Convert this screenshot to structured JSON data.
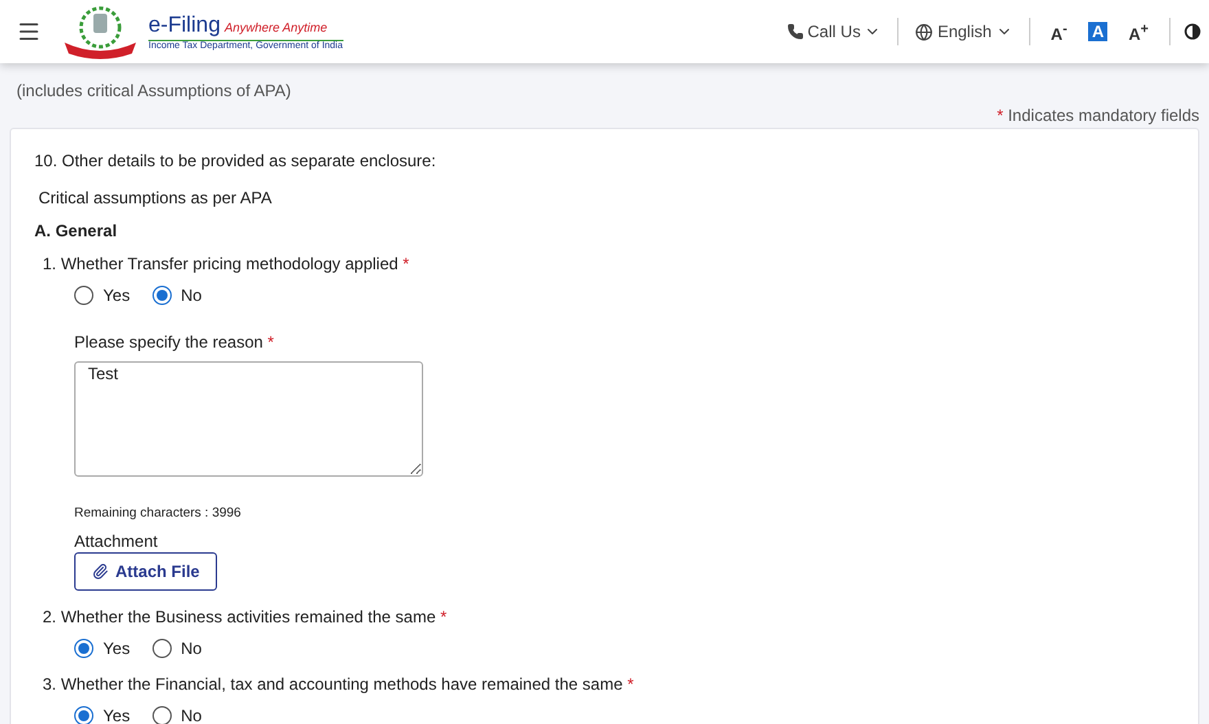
{
  "header": {
    "brand": "e-Filing",
    "tagline": "Anywhere Anytime",
    "department": "Income Tax Department, Government of India",
    "call_us": "Call Us",
    "language": "English",
    "font_controls": [
      {
        "label": "A",
        "sign": "-",
        "selected": false
      },
      {
        "label": "A",
        "selected": true
      },
      {
        "label": "A",
        "sign": "+",
        "selected": false
      }
    ]
  },
  "subtitle": "(includes critical Assumptions of APA)",
  "mandatory_mark": "*",
  "mandatory_note": "Indicates mandatory fields",
  "section_title": "10. Other details to be provided as separate enclosure:",
  "section_subtitle": "Critical assumptions as per APA",
  "group_title": "A. General",
  "questions": [
    {
      "text": "1. Whether Transfer pricing methodology applied",
      "required_mark": "*",
      "options": [
        {
          "label": "Yes",
          "selected": false
        },
        {
          "label": "No",
          "selected": true
        }
      ],
      "reason": {
        "label": "Please specify the reason",
        "required_mark": "*",
        "value": "Test",
        "remaining": "Remaining characters : 3996",
        "attachment_label": "Attachment",
        "attach_button": "Attach File"
      }
    },
    {
      "text": "2. Whether the Business activities remained the same",
      "required_mark": "*",
      "options": [
        {
          "label": "Yes",
          "selected": true
        },
        {
          "label": "No",
          "selected": false
        }
      ]
    },
    {
      "text": "3. Whether the Financial, tax and accounting methods have remained the same",
      "required_mark": "*",
      "options": [
        {
          "label": "Yes",
          "selected": true
        },
        {
          "label": "No",
          "selected": false
        }
      ]
    }
  ]
}
